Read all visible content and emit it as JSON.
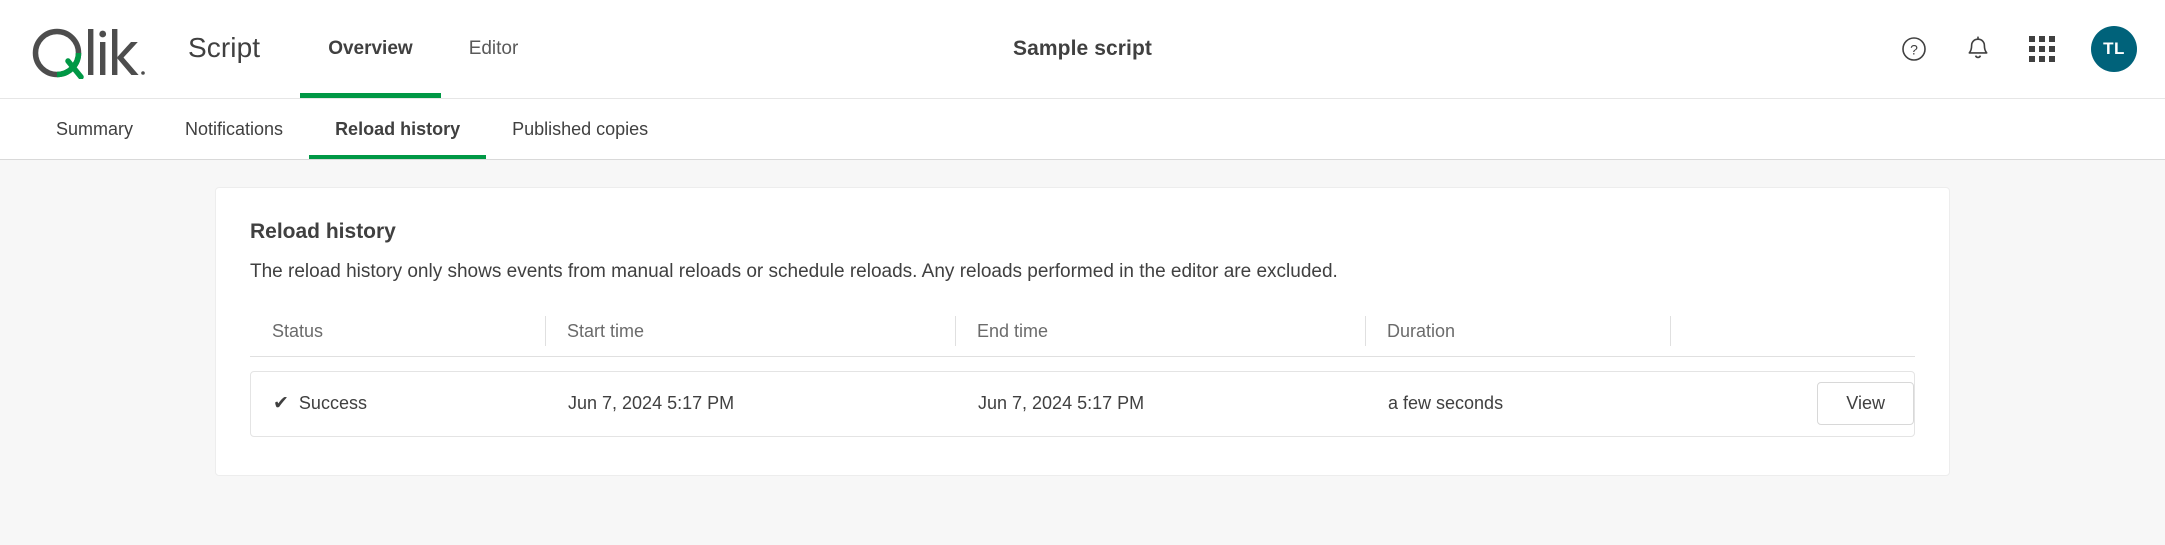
{
  "brand": {
    "logo_text": "Qlik",
    "logo_green": "#009845",
    "logo_dark": "#4d4d4d",
    "accent_green": "#009845"
  },
  "header": {
    "app_name": "Script",
    "center_title": "Sample script",
    "nav": [
      {
        "label": "Overview",
        "active": true
      },
      {
        "label": "Editor",
        "active": false
      }
    ],
    "actions": [
      {
        "name": "help-icon",
        "label": "?"
      },
      {
        "name": "bell-icon",
        "label": ""
      },
      {
        "name": "app-launcher-icon",
        "label": ""
      }
    ],
    "avatar": {
      "initials": "TL",
      "color": "#00627a"
    }
  },
  "subtabs": [
    {
      "label": "Summary",
      "active": false
    },
    {
      "label": "Notifications",
      "active": false
    },
    {
      "label": "Reload history",
      "active": true
    },
    {
      "label": "Published copies",
      "active": false
    }
  ],
  "card": {
    "title": "Reload history",
    "description": "The reload history only shows events from manual reloads or schedule reloads. Any reloads performed in the editor are excluded.",
    "table": {
      "columns": [
        "Status",
        "Start time",
        "End time",
        "Duration",
        ""
      ],
      "rows": [
        {
          "status_icon": "✔",
          "status": "Success",
          "start_time": "Jun 7, 2024 5:17 PM",
          "end_time": "Jun 7, 2024 5:17 PM",
          "duration": "a few seconds",
          "action_label": "View"
        }
      ]
    }
  }
}
